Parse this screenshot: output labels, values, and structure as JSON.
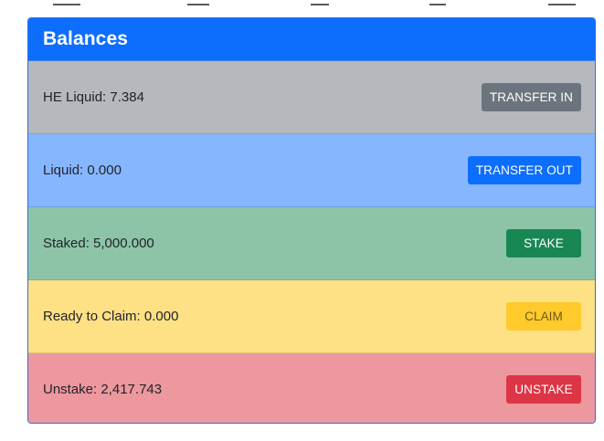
{
  "card": {
    "title": "Balances",
    "header_color": "#0d6efd",
    "rows": [
      {
        "label": "HE Liquid: 7.384",
        "button": "TRANSFER IN",
        "row_color": "#b5b8bc",
        "button_color": "#6c757d",
        "button_text_color": "#ffffff"
      },
      {
        "label": "Liquid: 0.000",
        "button": "TRANSFER OUT",
        "row_color": "#86b6fe",
        "button_color": "#0d6efd",
        "button_text_color": "#ffffff"
      },
      {
        "label": "Staked: 5,000.000",
        "button": "STAKE",
        "row_color": "#8dc4a8",
        "button_color": "#198754",
        "button_text_color": "#ffffff"
      },
      {
        "label": "Ready to Claim: 0.000",
        "button": "CLAIM",
        "row_color": "#fee085",
        "button_color": "#ffca2c",
        "button_text_color": "#6b5a1e"
      },
      {
        "label": "Unstake: 2,417.743",
        "button": "UNSTAKE",
        "row_color": "#ed979e",
        "button_color": "#dc3545",
        "button_text_color": "#ffffff"
      }
    ]
  }
}
